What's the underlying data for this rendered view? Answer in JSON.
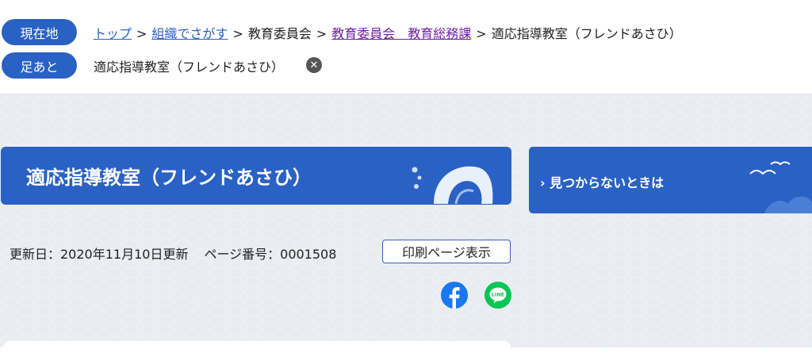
{
  "nav": {
    "current_location_label": "現在地",
    "footprint_label": "足あと",
    "breadcrumbs": [
      {
        "label": "トップ",
        "link": true,
        "color": "#2a61c4"
      },
      {
        "label": "組織でさがす",
        "link": true,
        "color": "#2a61c4"
      },
      {
        "label": "教育委員会",
        "link": false
      },
      {
        "label": "教育委員会　教育総務課",
        "link": true,
        "color": "#6b1fa0"
      },
      {
        "label": "適応指導教室（フレンドあさひ）",
        "link": false
      }
    ],
    "separator": ">",
    "footprint_item": "適応指導教室（フレンドあさひ）",
    "footprint_close_icon": "close-icon"
  },
  "page": {
    "title": "適応指導教室（フレンドあさひ）",
    "updated": "更新日：2020年11月10日更新",
    "page_number": "ページ番号：0001508",
    "print_button": "印刷ページ表示",
    "share_icons": [
      "facebook-icon",
      "line-icon"
    ]
  },
  "side": {
    "help_banner": "見つからないときは"
  },
  "colors": {
    "primary": "#2a61c4",
    "background": "#e9ecf1",
    "visited_link": "#6b1fa0",
    "facebook": "#1877f2",
    "line": "#06c755"
  }
}
